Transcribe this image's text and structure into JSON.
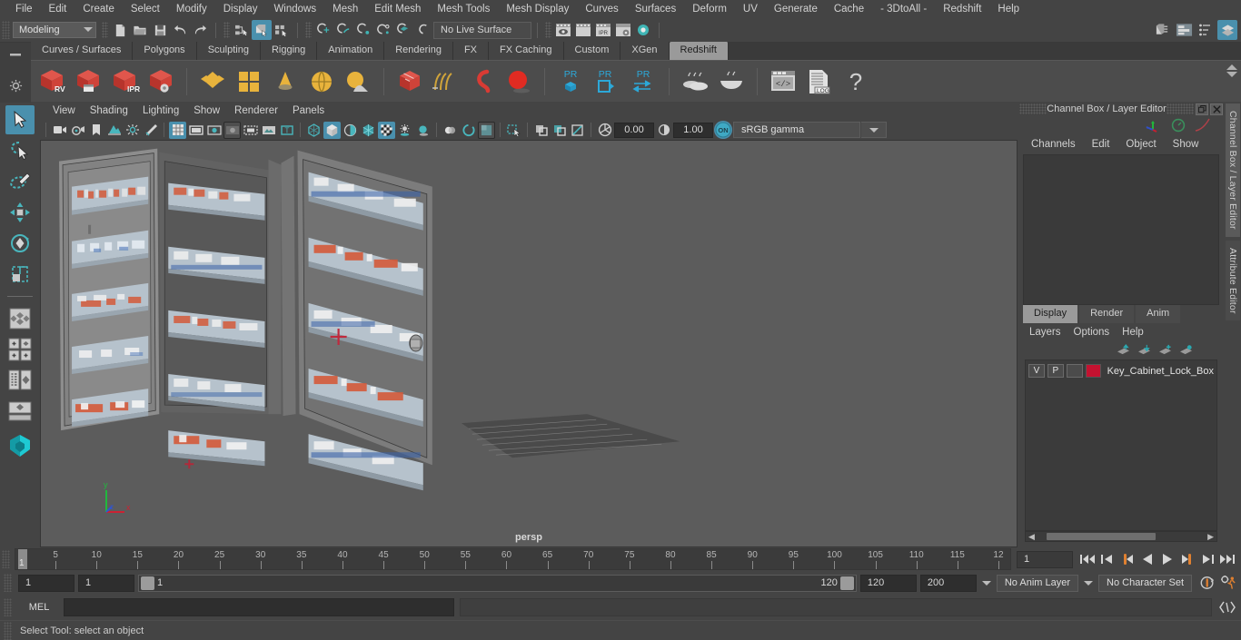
{
  "app": {
    "title": "Autodesk Maya",
    "menu": [
      "File",
      "Edit",
      "Create",
      "Select",
      "Modify",
      "Display",
      "Windows",
      "Mesh",
      "Edit Mesh",
      "Mesh Tools",
      "Mesh Display",
      "Curves",
      "Surfaces",
      "Deform",
      "UV",
      "Generate",
      "Cache",
      "- 3DtoAll -",
      "Redshift",
      "Help"
    ]
  },
  "status_line": {
    "mode": "Modeling",
    "live_surface": "No Live Surface",
    "file_icons": [
      "new-scene-icon",
      "open-scene-icon",
      "save-scene-icon",
      "undo-icon",
      "redo-icon"
    ],
    "select_mode_icons": [
      "select-by-hierarchy-icon",
      "select-by-object-type-icon",
      "select-by-component-type-icon"
    ],
    "snap_icons": [
      "snap-to-grid-icon",
      "snap-to-curve-icon",
      "snap-to-point-icon",
      "snap-to-projected-center-icon",
      "snap-to-view-plane-icon",
      "make-live-icon"
    ],
    "render_icons": [
      "render-current-frame-icon",
      "ipr-render-icon",
      "render-sequence-icon",
      "render-settings-icon",
      "hypershade-icon",
      "render-view-icon"
    ],
    "editor_icons": [
      "outliner-icon",
      "attribute-editor-icon",
      "tool-settings-icon",
      "channel-box-layer-editor-icon"
    ]
  },
  "shelf": {
    "tabs": [
      "Curves / Surfaces",
      "Polygons",
      "Sculpting",
      "Rigging",
      "Animation",
      "Rendering",
      "FX",
      "FX Caching",
      "Custom",
      "XGen",
      "Redshift"
    ],
    "active_tab": "Redshift",
    "buttons": [
      {
        "name": "redshift-render-view",
        "label": "RV"
      },
      {
        "name": "redshift-render-sequence",
        "label": ""
      },
      {
        "name": "redshift-ipr",
        "label": "IPR"
      },
      {
        "name": "redshift-render-settings",
        "label": ""
      },
      {
        "name": "redshift-material",
        "label": ""
      },
      {
        "name": "redshift-texture",
        "label": ""
      },
      {
        "name": "redshift-light-cone",
        "label": ""
      },
      {
        "name": "redshift-dome-light",
        "label": ""
      },
      {
        "name": "redshift-sun-sky",
        "label": ""
      },
      {
        "name": "redshift-proxy",
        "label": ""
      },
      {
        "name": "redshift-hair",
        "label": ""
      },
      {
        "name": "redshift-curve",
        "label": ""
      },
      {
        "name": "redshift-sphere",
        "label": ""
      },
      {
        "name": "redshift-pr-object",
        "label": "PR"
      },
      {
        "name": "redshift-pr-export",
        "label": "PR"
      },
      {
        "name": "redshift-pr-transfer",
        "label": "PR"
      },
      {
        "name": "redshift-bokeh",
        "label": ""
      },
      {
        "name": "redshift-bokeh-2",
        "label": ""
      },
      {
        "name": "redshift-script-editor",
        "label": ""
      },
      {
        "name": "redshift-log",
        "label": ".LOG"
      },
      {
        "name": "redshift-help",
        "label": "?"
      }
    ]
  },
  "toolbox": {
    "items": [
      {
        "name": "select-tool",
        "selected": true
      },
      {
        "name": "lasso-select-tool",
        "selected": false
      },
      {
        "name": "paint-select-tool",
        "selected": false
      },
      {
        "name": "move-tool",
        "selected": false
      },
      {
        "name": "rotate-tool",
        "selected": false
      },
      {
        "name": "scale-tool",
        "selected": false
      },
      {
        "name": "last-tool-used",
        "selected": false
      },
      {
        "name": "four-view-layout",
        "selected": false
      },
      {
        "name": "persp-outliner-layout",
        "selected": false
      },
      {
        "name": "persp-graph-layout",
        "selected": false
      },
      {
        "name": "single-perspective-layout",
        "selected": false
      }
    ]
  },
  "viewport": {
    "menu": [
      "View",
      "Shading",
      "Lighting",
      "Show",
      "Renderer",
      "Panels"
    ],
    "camera_label": "persp",
    "exposure": "0.00",
    "gamma": "1.00",
    "color_management": "sRGB gamma",
    "toolbar_icons": [
      "select-camera-icon",
      "camera-attributes-icon",
      "bookmark-icon",
      "image-plane-icon",
      "two-d-pan-zoom-icon",
      "grease-pencil-icon",
      "grid-toggle-icon",
      "film-gate-icon",
      "resolution-gate-icon",
      "gate-mask-icon",
      "film-origin-icon",
      "safe-action-icon",
      "texture-borders-icon",
      "wireframe-icon",
      "smooth-shade-all-icon",
      "shaded-wireframe-icon",
      "textured-icon",
      "use-all-lights-icon",
      "shadows-icon",
      "ambient-occlusion-icon",
      "motion-blur-icon",
      "multisample-icon",
      "depth-of-field-icon",
      "isolate-select-icon",
      "xray-icon",
      "xray-joints-icon",
      "xray-active-components-icon",
      "exposure-icon"
    ],
    "axis_labels": {
      "x": "x",
      "y": "y",
      "z": "z"
    },
    "scene_object": "Key_Cabinet_Lock_Box"
  },
  "right_dock": {
    "panel_title": "Channel Box / Layer Editor",
    "vertical_tabs": [
      "Channel Box / Layer Editor",
      "Attribute Editor"
    ],
    "channel_menu": [
      "Channels",
      "Edit",
      "Object",
      "Show"
    ],
    "layer_tabs": [
      "Display",
      "Render",
      "Anim"
    ],
    "layer_active_tab": "Display",
    "layer_menu": [
      "Layers",
      "Options",
      "Help"
    ],
    "layer_buttons": [
      "move-layer-up-icon",
      "move-layer-down-icon",
      "create-new-layer-icon",
      "create-layer-from-selected-icon"
    ],
    "layers": [
      {
        "visibility": "V",
        "playback": "P",
        "type": "",
        "color": "#c41230",
        "name": "Key_Cabinet_Lock_Box"
      }
    ]
  },
  "time_slider": {
    "tick_labels": [
      "5",
      "10",
      "15",
      "20",
      "25",
      "30",
      "35",
      "40",
      "45",
      "50",
      "55",
      "60",
      "65",
      "70",
      "75",
      "80",
      "85",
      "90",
      "95",
      "100",
      "105",
      "110",
      "115",
      "12"
    ],
    "current_frame_marker": "1",
    "current_frame_field": "1",
    "transport": [
      "go-to-start-icon",
      "step-back-frame-icon",
      "step-back-key-icon",
      "play-backwards-icon",
      "play-forwards-icon",
      "step-forward-key-icon",
      "step-forward-frame-icon",
      "go-to-end-icon"
    ]
  },
  "range_row": {
    "anim_start": "1",
    "range_start": "1",
    "range_bar_start_label": "1",
    "range_bar_end_label": "120",
    "range_end": "120",
    "anim_end": "200",
    "anim_layer": "No Anim Layer",
    "character_set": "No Character Set",
    "right_icons": [
      "auto-keyframe-icon",
      "animation-preferences-icon"
    ]
  },
  "command_line": {
    "language": "MEL",
    "input_value": "",
    "output_value": "",
    "script_editor_icon": "script-editor-icon"
  },
  "help_line": {
    "text": "Select Tool: select an object"
  },
  "colors": {
    "accent": "#4a90ad",
    "shelf_red": "#d0453e",
    "shelf_yellow": "#e8b33c",
    "layer_color": "#c41230",
    "bg": "#444444",
    "viewport_bg": "#5c5c5c"
  }
}
